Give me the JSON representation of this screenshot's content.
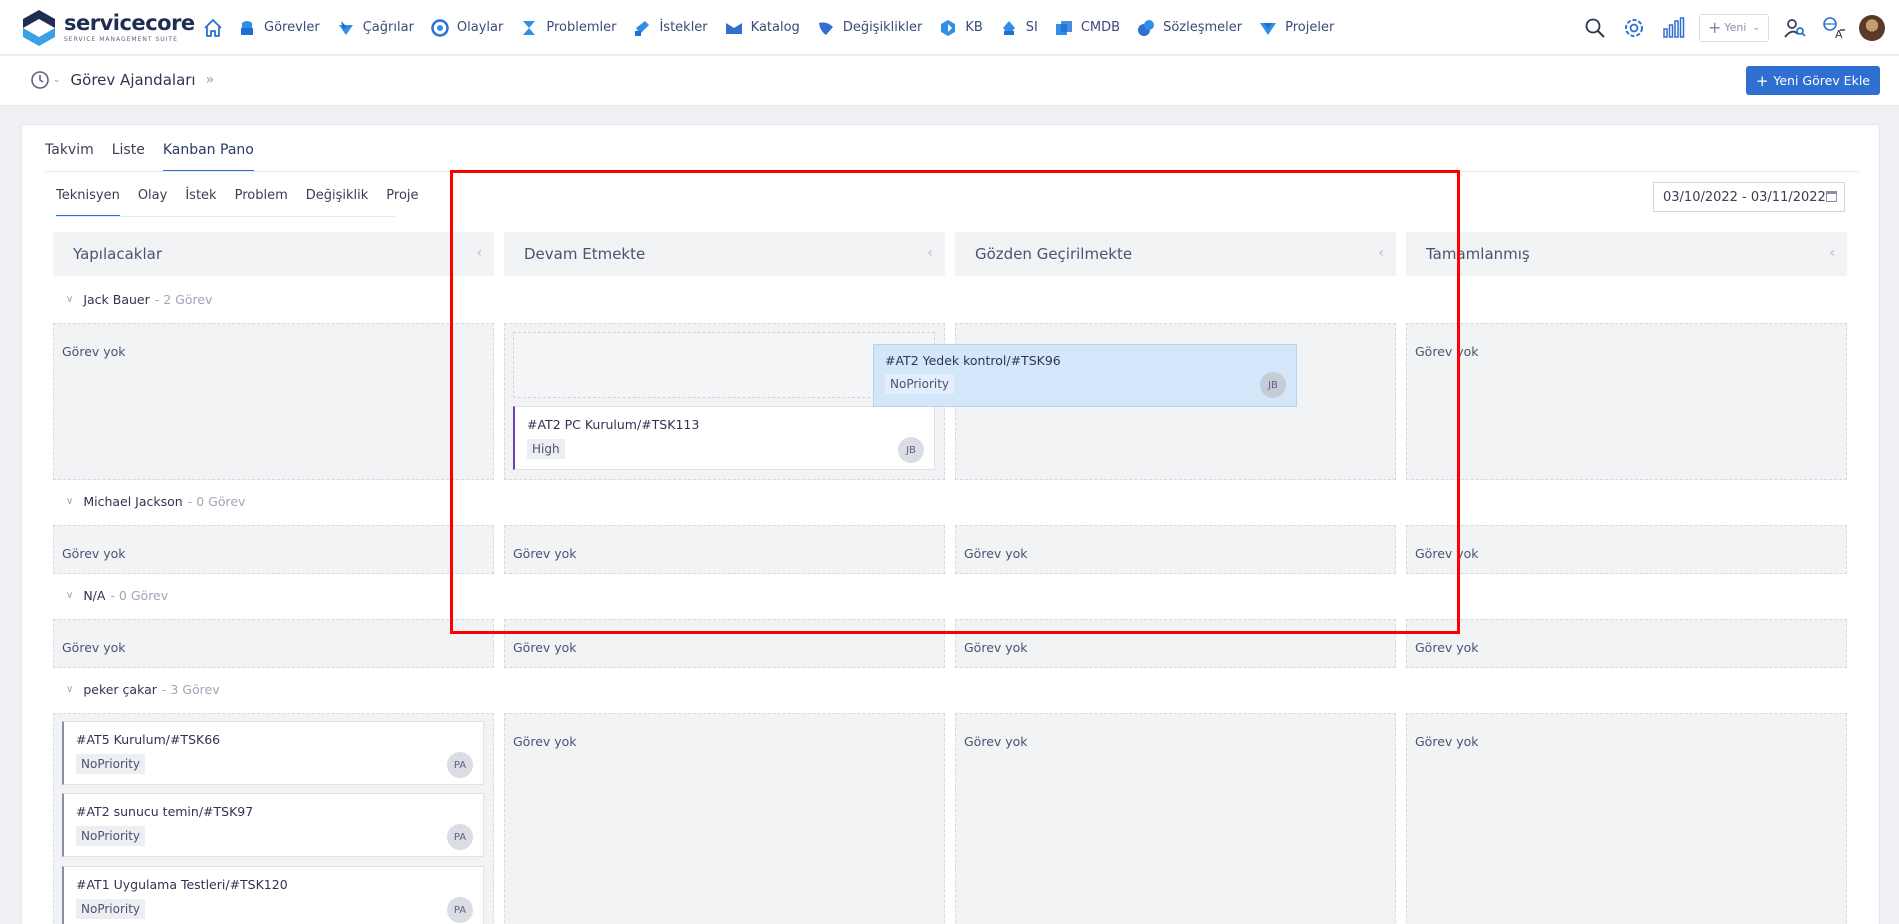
{
  "brand": {
    "name_part1": "service",
    "name_part2": "core",
    "tagline": "SERVICE MANAGEMENT SUITE"
  },
  "nav": {
    "items": [
      {
        "label": "Görevler",
        "icon": "tasks-icon",
        "color": "#2f8fe8"
      },
      {
        "label": "Çağrılar",
        "icon": "calls-icon",
        "color": "#2f8fe8"
      },
      {
        "label": "Olaylar",
        "icon": "incidents-icon",
        "color": "#2f6fd1"
      },
      {
        "label": "Problemler",
        "icon": "problems-icon",
        "color": "#2f6fd1"
      },
      {
        "label": "İstekler",
        "icon": "requests-icon",
        "color": "#2f8fe8"
      },
      {
        "label": "Katalog",
        "icon": "catalog-icon",
        "color": "#2f6fd1"
      },
      {
        "label": "Değişiklikler",
        "icon": "changes-icon",
        "color": "#2f6fd1"
      },
      {
        "label": "KB",
        "icon": "kb-icon",
        "color": "#2f6fd1"
      },
      {
        "label": "SI",
        "icon": "si-icon",
        "color": "#2f8fe8"
      },
      {
        "label": "CMDB",
        "icon": "cmdb-icon",
        "color": "#2f8fe8"
      },
      {
        "label": "Sözleşmeler",
        "icon": "contracts-icon",
        "color": "#2f6fd1"
      },
      {
        "label": "Projeler",
        "icon": "projects-icon",
        "color": "#2f8fe8"
      }
    ],
    "new_button_label": "Yeni"
  },
  "subheader": {
    "title": "Görev Ajandaları",
    "add_button_label": "Yeni Görev Ekle"
  },
  "view_tabs": [
    "Takvim",
    "Liste",
    "Kanban Pano"
  ],
  "view_tabs_active": "Kanban Pano",
  "filter_tabs": [
    "Teknisyen",
    "Olay",
    "İstek",
    "Problem",
    "Değişiklik",
    "Proje"
  ],
  "filter_tabs_active": "Teknisyen",
  "date_range": "03/10/2022 - 03/11/2022",
  "columns": [
    "Yapılacaklar",
    "Devam Etmekte",
    "Gözden Geçirilmekte",
    "Tamamlanmış"
  ],
  "empty_label": "Görev yok",
  "groups": [
    {
      "name": "Jack Bauer",
      "count": "- 2 Görev"
    },
    {
      "name": "Michael Jackson",
      "count": "- 0 Görev"
    },
    {
      "name": "N/A",
      "count": "- 0 Görev"
    },
    {
      "name": "peker çakar",
      "count": "- 3 Görev"
    }
  ],
  "cards": {
    "jack_inprogress": {
      "title": "#AT2 PC Kurulum/#TSK113",
      "priority": "High",
      "assignee": "JB"
    },
    "dragging": {
      "title": "#AT2 Yedek kontrol/#TSK96",
      "priority": "NoPriority",
      "assignee": "JB"
    },
    "peker_todo": [
      {
        "title": "#AT5 Kurulum/#TSK66",
        "priority": "NoPriority",
        "assignee": "PA"
      },
      {
        "title": "#AT2 sunucu temin/#TSK97",
        "priority": "NoPriority",
        "assignee": "PA"
      },
      {
        "title": "#AT1 Uygulama Testleri/#TSK120",
        "priority": "NoPriority",
        "assignee": "PA"
      }
    ]
  },
  "colors": {
    "accent": "#2f6fd1",
    "high_priority": "#6b3fb3",
    "drag_card": "#d3e6fa",
    "highlight": "#ff0000"
  }
}
